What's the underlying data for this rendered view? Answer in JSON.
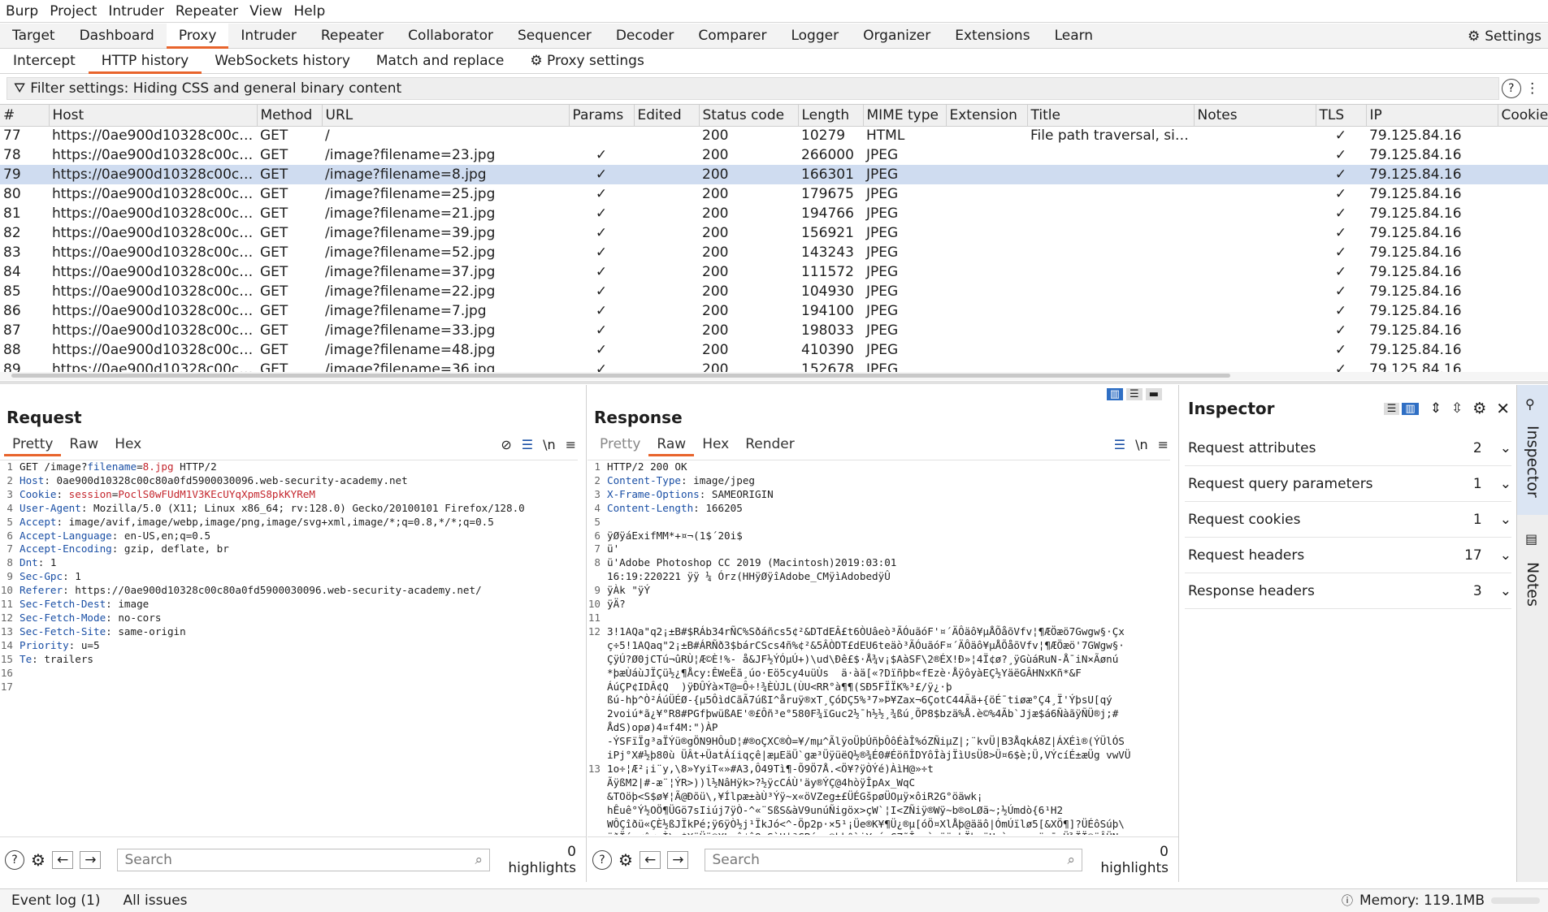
{
  "menubar": [
    "Burp",
    "Project",
    "Intruder",
    "Repeater",
    "View",
    "Help"
  ],
  "main_tabs": {
    "items": [
      "Target",
      "Dashboard",
      "Proxy",
      "Intruder",
      "Repeater",
      "Collaborator",
      "Sequencer",
      "Decoder",
      "Comparer",
      "Logger",
      "Organizer",
      "Extensions",
      "Learn"
    ],
    "active": "Proxy",
    "settings_label": "Settings"
  },
  "sub_tabs": {
    "items": [
      "Intercept",
      "HTTP history",
      "WebSockets history",
      "Match and replace"
    ],
    "active": "HTTP history",
    "proxy_settings": "Proxy settings"
  },
  "filter": {
    "text": "Filter settings: Hiding CSS and general binary content"
  },
  "history": {
    "columns": [
      "#",
      "Host",
      "Method",
      "URL",
      "Params",
      "Edited",
      "Status code",
      "Length",
      "MIME type",
      "Extension",
      "Title",
      "Notes",
      "TLS",
      "IP",
      "Cookie"
    ],
    "rows": [
      {
        "n": "77",
        "host": "https://0ae900d10328c00c8...",
        "method": "GET",
        "url": "/",
        "params": "",
        "status": "200",
        "length": "10279",
        "mime": "HTML",
        "title": "File path traversal, sim...",
        "tls": "✓",
        "ip": "79.125.84.16"
      },
      {
        "n": "78",
        "host": "https://0ae900d10328c00c8...",
        "method": "GET",
        "url": "/image?filename=23.jpg",
        "params": "✓",
        "status": "200",
        "length": "266000",
        "mime": "JPEG",
        "title": "",
        "tls": "✓",
        "ip": "79.125.84.16"
      },
      {
        "n": "79",
        "host": "https://0ae900d10328c00c8...",
        "method": "GET",
        "url": "/image?filename=8.jpg",
        "params": "✓",
        "status": "200",
        "length": "166301",
        "mime": "JPEG",
        "title": "",
        "tls": "✓",
        "ip": "79.125.84.16",
        "selected": true
      },
      {
        "n": "80",
        "host": "https://0ae900d10328c00c8...",
        "method": "GET",
        "url": "/image?filename=25.jpg",
        "params": "✓",
        "status": "200",
        "length": "179675",
        "mime": "JPEG",
        "title": "",
        "tls": "✓",
        "ip": "79.125.84.16"
      },
      {
        "n": "81",
        "host": "https://0ae900d10328c00c8...",
        "method": "GET",
        "url": "/image?filename=21.jpg",
        "params": "✓",
        "status": "200",
        "length": "194766",
        "mime": "JPEG",
        "title": "",
        "tls": "✓",
        "ip": "79.125.84.16"
      },
      {
        "n": "82",
        "host": "https://0ae900d10328c00c8...",
        "method": "GET",
        "url": "/image?filename=39.jpg",
        "params": "✓",
        "status": "200",
        "length": "156921",
        "mime": "JPEG",
        "title": "",
        "tls": "✓",
        "ip": "79.125.84.16"
      },
      {
        "n": "83",
        "host": "https://0ae900d10328c00c8...",
        "method": "GET",
        "url": "/image?filename=52.jpg",
        "params": "✓",
        "status": "200",
        "length": "143243",
        "mime": "JPEG",
        "title": "",
        "tls": "✓",
        "ip": "79.125.84.16"
      },
      {
        "n": "84",
        "host": "https://0ae900d10328c00c8...",
        "method": "GET",
        "url": "/image?filename=37.jpg",
        "params": "✓",
        "status": "200",
        "length": "111572",
        "mime": "JPEG",
        "title": "",
        "tls": "✓",
        "ip": "79.125.84.16"
      },
      {
        "n": "85",
        "host": "https://0ae900d10328c00c8...",
        "method": "GET",
        "url": "/image?filename=22.jpg",
        "params": "✓",
        "status": "200",
        "length": "104930",
        "mime": "JPEG",
        "title": "",
        "tls": "✓",
        "ip": "79.125.84.16"
      },
      {
        "n": "86",
        "host": "https://0ae900d10328c00c8...",
        "method": "GET",
        "url": "/image?filename=7.jpg",
        "params": "✓",
        "status": "200",
        "length": "194100",
        "mime": "JPEG",
        "title": "",
        "tls": "✓",
        "ip": "79.125.84.16"
      },
      {
        "n": "87",
        "host": "https://0ae900d10328c00c8...",
        "method": "GET",
        "url": "/image?filename=33.jpg",
        "params": "✓",
        "status": "200",
        "length": "198033",
        "mime": "JPEG",
        "title": "",
        "tls": "✓",
        "ip": "79.125.84.16"
      },
      {
        "n": "88",
        "host": "https://0ae900d10328c00c8...",
        "method": "GET",
        "url": "/image?filename=48.jpg",
        "params": "✓",
        "status": "200",
        "length": "410390",
        "mime": "JPEG",
        "title": "",
        "tls": "✓",
        "ip": "79.125.84.16"
      },
      {
        "n": "89",
        "host": "https://0ae900d10328c00c8...",
        "method": "GET",
        "url": "/image?filename=36.jpg",
        "params": "✓",
        "status": "200",
        "length": "152678",
        "mime": "JPEG",
        "title": "",
        "tls": "✓",
        "ip": "79.125.84.16"
      }
    ]
  },
  "request": {
    "title": "Request",
    "tabs": [
      "Pretty",
      "Raw",
      "Hex"
    ],
    "active_tab": "Pretty",
    "lines": [
      [
        "GET /image?",
        "filename",
        "=",
        "8.jpg",
        " HTTP/2"
      ],
      [
        "Host",
        ": 0ae900d10328c00c80a0fd5900030096.web-security-academy.net"
      ],
      [
        "Cookie",
        ": ",
        "session",
        "=",
        "PoclS0wFUdM1V3KEcUYqXpmS8pkKYReM"
      ],
      [
        "User-Agent",
        ": Mozilla/5.0 (X11; Linux x86_64; rv:128.0) Gecko/20100101 Firefox/128.0"
      ],
      [
        "Accept",
        ": image/avif,image/webp,image/png,image/svg+xml,image/*;q=0.8,*/*;q=0.5"
      ],
      [
        "Accept-Language",
        ": en-US,en;q=0.5"
      ],
      [
        "Accept-Encoding",
        ": gzip, deflate, br"
      ],
      [
        "Dnt",
        ": 1"
      ],
      [
        "Sec-Gpc",
        ": 1"
      ],
      [
        "Referer",
        ": https://0ae900d10328c00c80a0fd5900030096.web-security-academy.net/"
      ],
      [
        "Sec-Fetch-Dest",
        ": image"
      ],
      [
        "Sec-Fetch-Mode",
        ": no-cors"
      ],
      [
        "Sec-Fetch-Site",
        ": same-origin"
      ],
      [
        "Priority",
        ": u=5"
      ],
      [
        "Te",
        ": trailers"
      ],
      [
        ""
      ],
      [
        ""
      ]
    ],
    "search_placeholder": "Search",
    "highlights": "0 highlights"
  },
  "response": {
    "title": "Response",
    "tabs": [
      "Pretty",
      "Raw",
      "Hex",
      "Render"
    ],
    "active_tab": "Raw",
    "line_numbers": [
      "1",
      "2",
      "3",
      "4",
      "5",
      "6",
      "7",
      "8",
      "",
      "9",
      "10",
      "11",
      "12",
      "",
      "",
      "",
      "",
      "",
      "",
      "",
      "",
      "",
      "13",
      "",
      "",
      "",
      "",
      "",
      "14",
      ""
    ],
    "lines": [
      "HTTP/2 200 OK",
      "Content-Type: image/jpeg",
      "X-Frame-Options: SAMEORIGIN",
      "Content-Length: 166205",
      "",
      "ÿØÿáExifMM*+¤¬(1$´20i$",
      "ü'",
      "ü'Adobe Photoshop CC 2019 (Macintosh)2019:03:01",
      "16:19:220221 ÿÿ ¼ Órz(HHÿØÿîAdobe_CMÿìAdobedÿÛ",
      "ÿÀk \"ÿÝ",
      "ÿÄ?",
      "",
      "3!1AQa\"q2¡±B#$RÁb34rÑC%Sðáñcs5¢²&DTdEÂ£t6ÒUâeò³ÃÓuãóF'¤´ÄÔäô¥µÅÕåõVfv¦¶ÆÖæö7Gwgw§·Çx",
      "ç÷5!1AQaq\"2¡±B#ÁRÑð3$bárCScs4ñ%¢²&5ÂÒDT£dEU6teäò³ÃÓuãóF¤´ÄÔäô¥µÅÕåõVfv¦¶ÆÖæö'7GWgw§·",
      "ÇÿÚ?Ø0jCTú¬ûRÙ¦Æ©È!%- å&JF½ÝÓµÚ+)\\ud\\Ðê£$·Å¾v¡$AàSF\\2®ÉX!Ð»¦4Ï¢ø?¸ÿGùáRuN-Å¯iN×Ãønú",
      "*þæÙáùJÏÇü½¿¶Åcy:ÊWeËã¸úo·Eö5cy4uüÙs  ä·àä[«?Dïñþb«fEzè·ÅÿôyàEÇ½YäëGÂHNxKñ*&F",
      "ÁúÇP¢IDÂ¢Q  )ÿÐÛÝà×T@=Ô÷!¾ÈÙJL(ÙU<RR°à¶¶(SÐ5FÏÏK%³£/ÿ¿·þ",
      "ßú-hþ^Ò²ÁúÜÉØ-{µ5ÔìdCãÃ7úßI^åruÿ®xT¸ÇóDÇ5%³7»Þ¥Zax¬6ÇotC44Ãä+{öÉ¯tiøæ°Ç4¸Ï'ÝþsU[qý",
      "2voiú*ã¿¥°R8#PGfþwüßAE'®£Ôñ³e°580F¾ïGuc2½¯h½½¸¾ßú¸ÕP8$bzä%Å.è©%4Ãb`Jjæ$á6ÑàãÿÑÜ®j;#",
      "ÅdS)opø)4¤f4M:\")ÀP",
      "-ÝSFïÏg³aÏÝü®gÖN9HÔuD¦#®oÇXC®Ò=¥/mµ^ÃlÿoÜþÚñþÔôÉàÎ%óZÑiµZ|;¨kvÜ|B3ÅqkÁ8Z|ÁXÉì®(ÝÜlÓS",
      "iPj°X#½þ80ù ÜÂt+ÜatÁíiqçê|æµEäÜ`gæ³ÜÿüëQ½®¾É0#ÉöñÎDYôÎàjÏìUsÜ8>Ü¤6$è;Ü,VÝcíÉ±æÜg vwVÜ",
      "1o÷¦Æ²¡i¨y,\\8»YyiT«»#A3,Ô49Tì¶-Õ9Ö7Å.<Ö¥?ÿÒÝé)ÀìH@»÷t",
      "ÃÿßM2|#-æ¨¦ÝR>))l½NâHÿk>?½ÿcCÁÙ'äy®ÝÇ@4hòÿÎpAx_WqC",
      "&TOöþ<S$ø¥¦Ã@Ðõü\\,¥Ílpæ±àÙ³Ýÿ~x«öVZeg±£ÜÉGšpøÜOµÿ×ôiR2G°öäwk¡",
      "hÊuê°Ý½OÖ¶ÜGö7sIiúj7ÿÒ-^«¨SßS&àV9unúÑigöx>çW`¦I<ZÑiÿ®Wÿ~b®oLØä~;½Úmdò{6¹H2",
      "WÔÇîðü«ÇÈ½ßJÏkPé;ÿ6ÿÒ½j¹ÏkJó<^-Öp2p·×5¹¡Üe®K¥¶Ü¿®µ[óÖ¤XlÅþ@ääô|ÓmÚïlø5[&XÖ¶]?ÜÉôSúþ\\",
      "üðÏý¸øîøµÌ\\r$XöÜÿ®XL»ô¢û8>SùU|ªCPí¡>®kk°ìi¥·ú<ÇZõÎ-.òsöÿgþÏþsäH¬àm-s«¡ö=¯pÜ¾ÏÏ®ÿÂÜN",
      "\\ÁÔ7 -ÿ¸ÖÝü¸ÌßÖÿ/±Ü 3· ÆÈ¸¼ºØª¿ºÔæ·ÁÃÙ¨ÿÆö¸¨ÁÝ¸×¼¢Ì³óÀÊÊÇµ ×Ãú·¾µêÒÀÂ±¿ ÖÝÖÒÜ"
    ],
    "search_placeholder": "Search",
    "highlights": "0 highlights"
  },
  "inspector": {
    "title": "Inspector",
    "sections": [
      {
        "label": "Request attributes",
        "count": "2"
      },
      {
        "label": "Request query parameters",
        "count": "1"
      },
      {
        "label": "Request cookies",
        "count": "1"
      },
      {
        "label": "Request headers",
        "count": "17"
      },
      {
        "label": "Response headers",
        "count": "3"
      }
    ]
  },
  "side_tabs": [
    "Inspector",
    "Notes"
  ],
  "statusbar": {
    "event_log": "Event log (1)",
    "all_issues": "All issues",
    "memory": "Memory: 119.1MB"
  },
  "colors": {
    "accent": "#e8642c",
    "selected_row": "#cfdcf0",
    "header_key": "#1a4fa5",
    "cookie_value": "#c4262d"
  }
}
